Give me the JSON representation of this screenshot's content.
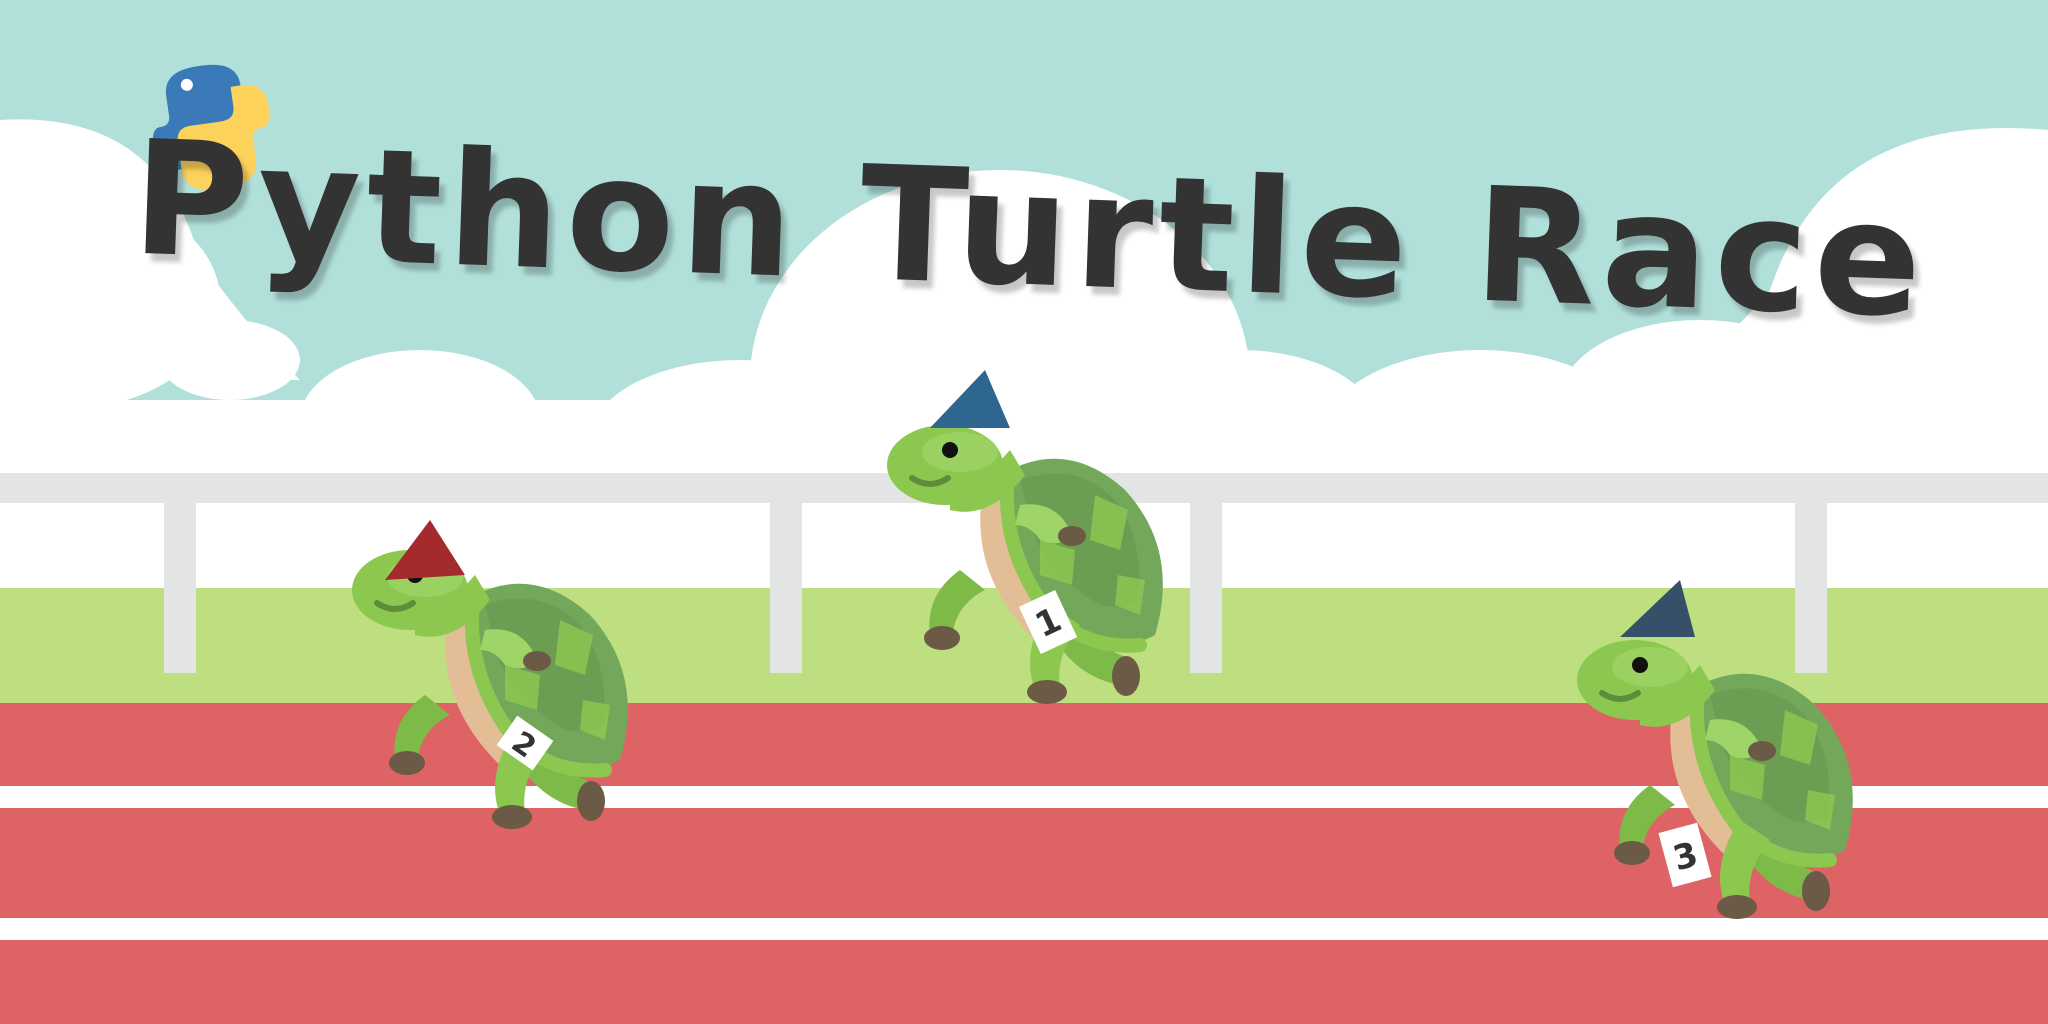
{
  "title": "Python Turtle Race",
  "logo": {
    "name": "python-logo",
    "colors": {
      "blue": "#3a7ab8",
      "yellow": "#fdd25b"
    }
  },
  "colors": {
    "sky": "#b1e0db",
    "cloud": "#ffffff",
    "fence": "#e3e5e5",
    "grass": "#bedf7f",
    "track": "#de6365",
    "lane_line": "#ffffff",
    "title_text": "#333333",
    "turtle_body": "#8cc850",
    "turtle_shell": "#73a85b",
    "turtle_belly": "#e3bd96"
  },
  "turtles": [
    {
      "name": "turtle-2",
      "bib": "2",
      "hat_color": "#a32b2e"
    },
    {
      "name": "turtle-1",
      "bib": "1",
      "hat_color": "#2f6690"
    },
    {
      "name": "turtle-3",
      "bib": "3",
      "hat_color": "#37506a"
    }
  ]
}
